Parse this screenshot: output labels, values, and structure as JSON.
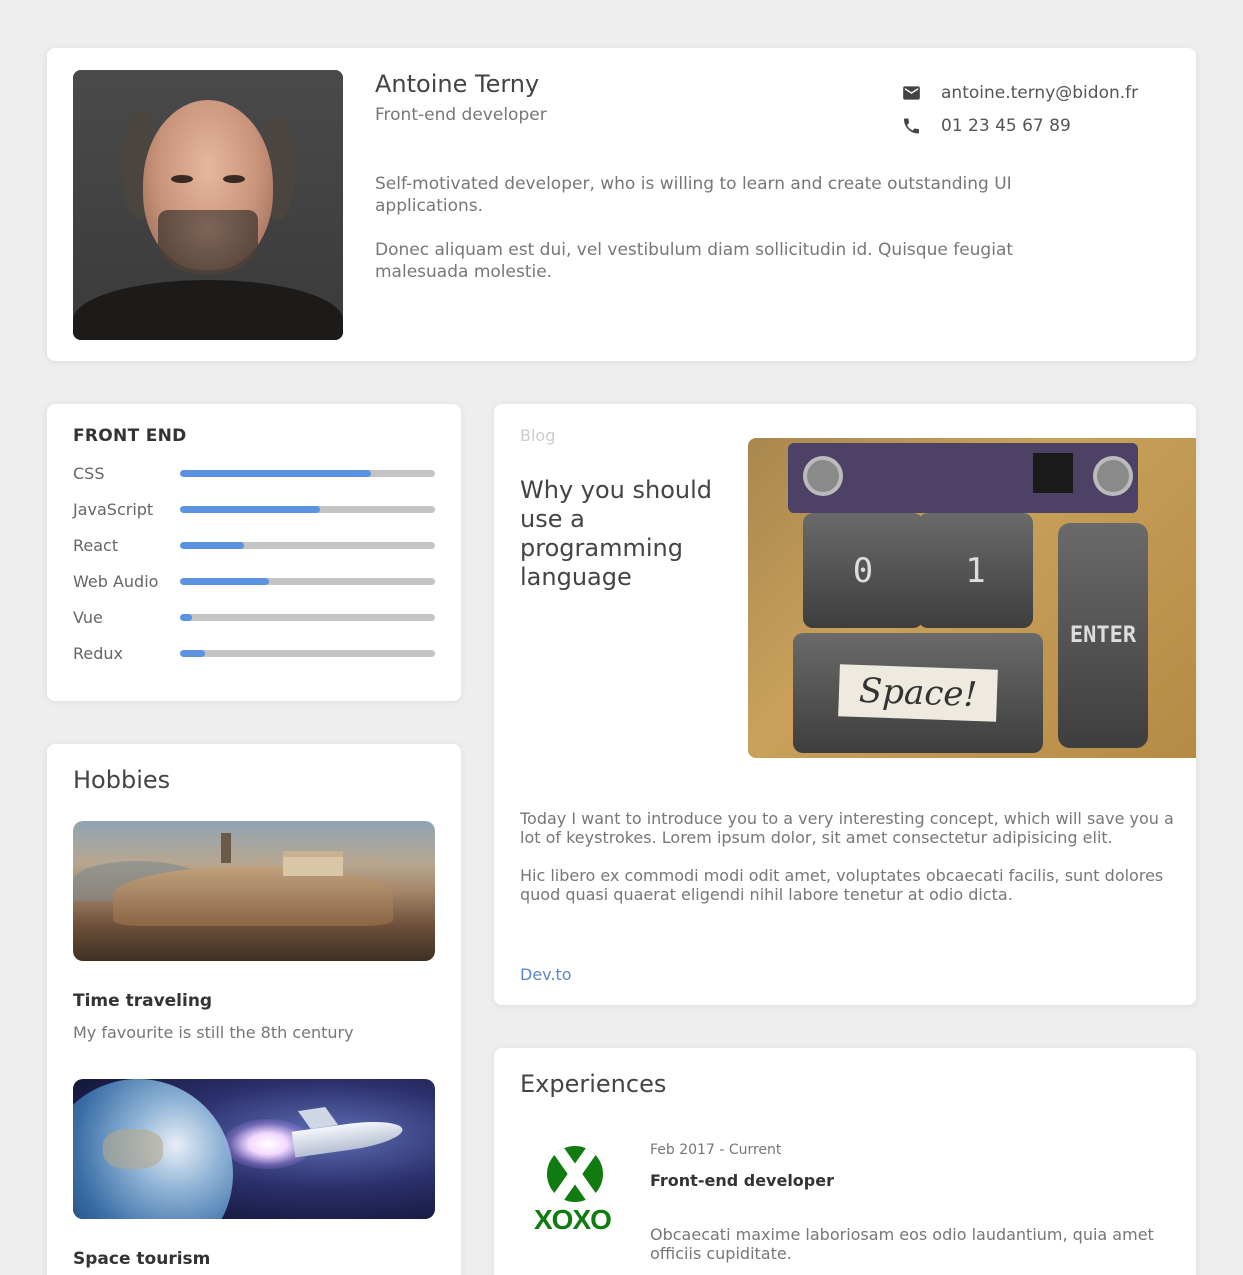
{
  "profile": {
    "name": "Antoine Terny",
    "role": "Front-end developer",
    "bio": [
      "Self-motivated developer, who is willing to learn and create outstanding UI applications.",
      "Donec aliquam est dui, vel vestibulum diam sollicitudin id. Quisque feugiat malesuada molestie."
    ],
    "email": "antoine.terny@bidon.fr",
    "phone": "01 23 45 67 89",
    "email_icon": "mail-icon",
    "phone_icon": "phone-icon"
  },
  "skills": {
    "title": "FRONT END",
    "bar_color": "#5b92e1",
    "track_color": "#c4c4c4",
    "items": [
      {
        "label": "CSS",
        "level": 0.75
      },
      {
        "label": "JavaScript",
        "level": 0.55
      },
      {
        "label": "React",
        "level": 0.25
      },
      {
        "label": "Web Audio",
        "level": 0.35
      },
      {
        "label": "Vue",
        "level": 0.05
      },
      {
        "label": "Redux",
        "level": 0.1
      }
    ]
  },
  "hobbies": {
    "title": "Hobbies",
    "items": [
      {
        "name": "Time traveling",
        "desc": "My favourite is still the 8th century"
      },
      {
        "name": "Space tourism",
        "desc": ""
      }
    ]
  },
  "blog": {
    "label": "Blog",
    "title": "Why you should use a programming language",
    "image_keys": {
      "key0": "0",
      "key1": "1",
      "enter": "ENTER",
      "space": "Space!"
    },
    "paragraphs": [
      "Today I want to introduce you to a very interesting concept, which will save you a lot of keystrokes. Lorem ipsum dolor, sit amet consectetur adipisicing elit.",
      "Hic libero ex commodi modi odit amet, voluptates obcaecati facilis, sunt dolores quod quasi quaerat eligendi nihil labore tenetur at odio dicta."
    ],
    "link": "Dev.to",
    "link_color": "#5b86c7"
  },
  "experiences": {
    "title": "Experiences",
    "items": [
      {
        "logo_text": "XOXO",
        "date": "Feb 2017 - Current",
        "role": "Front-end developer",
        "desc": "Obcaecati maxime laboriosam eos odio laudantium, quia amet officiis cupiditate."
      }
    ]
  }
}
